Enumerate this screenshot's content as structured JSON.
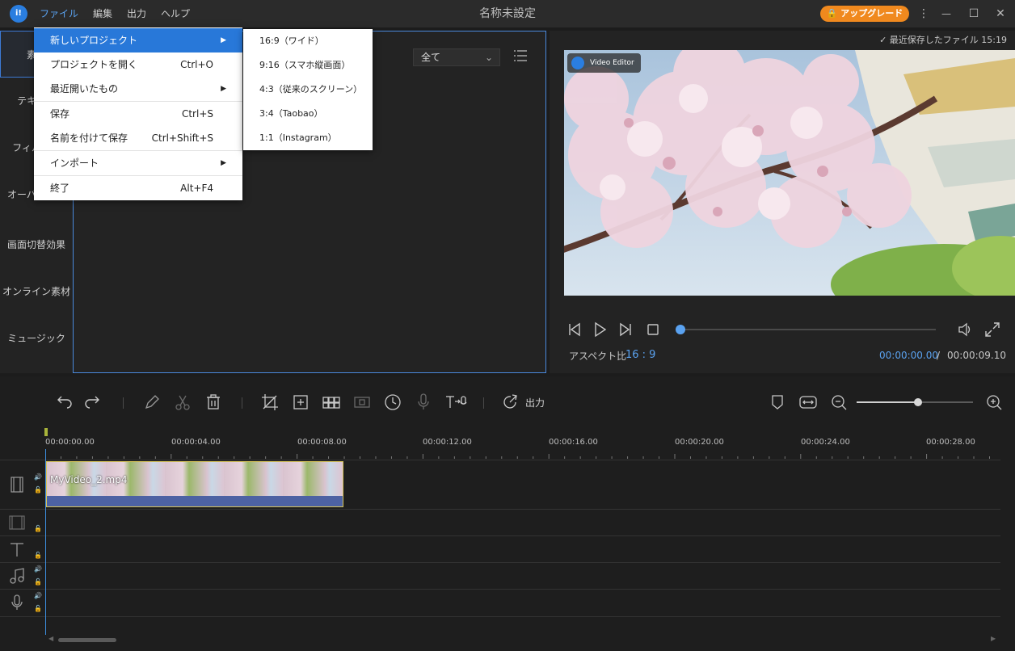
{
  "titlebar": {
    "logo": "i!",
    "menus": [
      "ファイル",
      "編集",
      "出力",
      "ヘルプ"
    ],
    "title": "名称未設定",
    "upgrade": "アップグレード"
  },
  "sidebar": {
    "items": [
      "素材",
      "テキスト",
      "フィルター",
      "オーバーレイ",
      "画面切替効果",
      "オンライン素材",
      "ミュージック"
    ]
  },
  "media": {
    "filter_value": "全て"
  },
  "preview": {
    "saved_text": "最近保存したファイル 15:19",
    "watermark": "Video Editor",
    "aspect_label": "アスペクト比",
    "aspect_value": "16 : 9",
    "time_current": "00:00:00.00",
    "time_separator": "/",
    "time_total": "00:00:09.10",
    "seek_position": 0.0
  },
  "toolbar": {
    "export_label": "出力",
    "zoom_level": 0.53
  },
  "timeline": {
    "ticks": [
      "00:00:00.00",
      "00:00:04.00",
      "00:00:08.00",
      "00:00:12.00",
      "00:00:16.00",
      "00:00:20.00",
      "00:00:24.00",
      "00:00:28.00"
    ],
    "clip_name": "MyVideo_2.mp4"
  },
  "file_menu": {
    "items": [
      {
        "label": "新しいプロジェクト",
        "shortcut": "",
        "submenu": true
      },
      {
        "label": "プロジェクトを開く",
        "shortcut": "Ctrl+O",
        "submenu": false
      },
      {
        "label": "最近開いたもの",
        "shortcut": "",
        "submenu": true
      },
      {
        "label": "保存",
        "shortcut": "Ctrl+S",
        "submenu": false
      },
      {
        "label": "名前を付けて保存",
        "shortcut": "Ctrl+Shift+S",
        "submenu": false
      },
      {
        "label": "インポート",
        "shortcut": "",
        "submenu": true
      },
      {
        "label": "終了",
        "shortcut": "Alt+F4",
        "submenu": false
      }
    ],
    "submenu_arrow": "▶"
  },
  "new_project_submenu": {
    "items": [
      "16:9（ワイド）",
      "9:16（スマホ縦画面）",
      "4:3（従来のスクリーン）",
      "3:4（Taobao）",
      "1:1（Instagram）"
    ]
  },
  "window_controls": {
    "more_icon": "⋮",
    "minimize_icon": "—",
    "maximize_icon": "☐",
    "close_icon": "✕"
  }
}
